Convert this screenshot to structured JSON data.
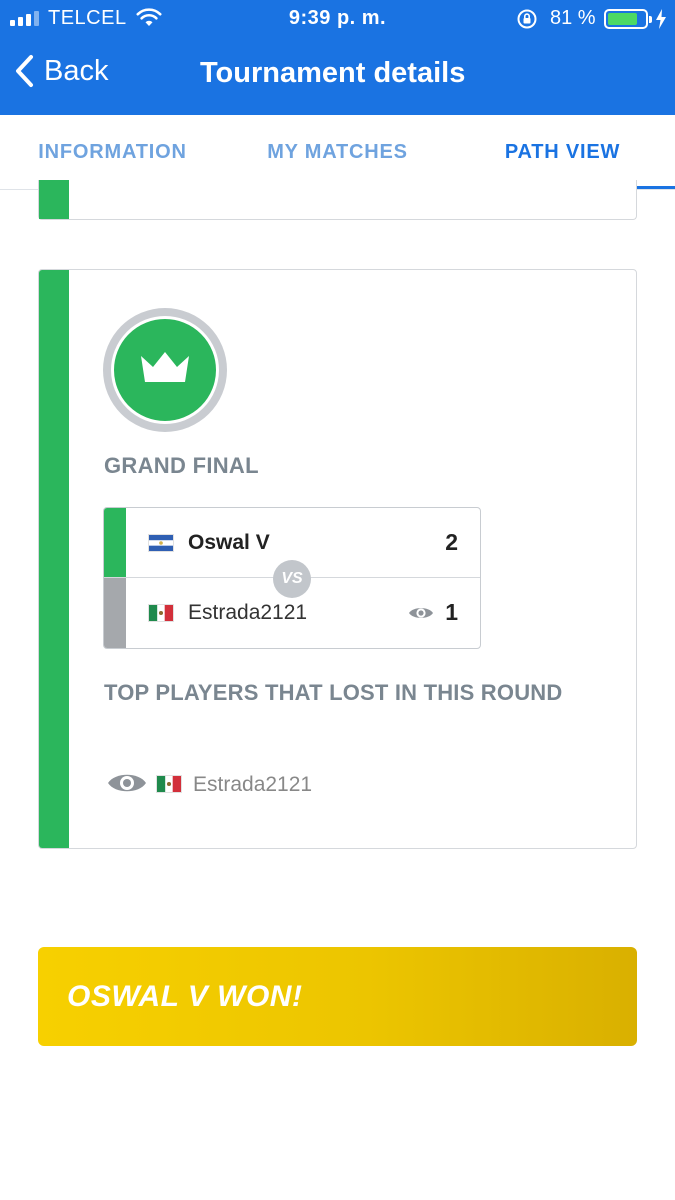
{
  "status_bar": {
    "carrier": "TELCEL",
    "time": "9:39 p. m.",
    "battery_percent": "81 %",
    "battery_level": 0.81
  },
  "nav": {
    "back_label": "Back",
    "title": "Tournament details"
  },
  "tabs": [
    {
      "label": "INFORMATION",
      "active": false
    },
    {
      "label": "MY MATCHES",
      "active": false
    },
    {
      "label": "PATH VIEW",
      "active": true
    }
  ],
  "round": {
    "title": "GRAND FINAL",
    "icon": "crown-icon",
    "match": {
      "vs_label": "VS",
      "players": [
        {
          "name": "Oswal V",
          "score": "2",
          "flag": "flag-el-salvador",
          "winner": true
        },
        {
          "name": "Estrada2121",
          "score": "1",
          "flag": "flag-mexico",
          "winner": false
        }
      ]
    },
    "lost_title": "TOP PLAYERS THAT LOST IN THIS ROUND",
    "lost_players": [
      {
        "name": "Estrada2121",
        "flag": "flag-mexico"
      }
    ]
  },
  "winner_banner": {
    "text": "OSWAL V WON!"
  },
  "colors": {
    "primary": "#1a73e2",
    "green": "#2bb65c",
    "gold": "#f7d000",
    "muted_text": "#7a8690"
  }
}
